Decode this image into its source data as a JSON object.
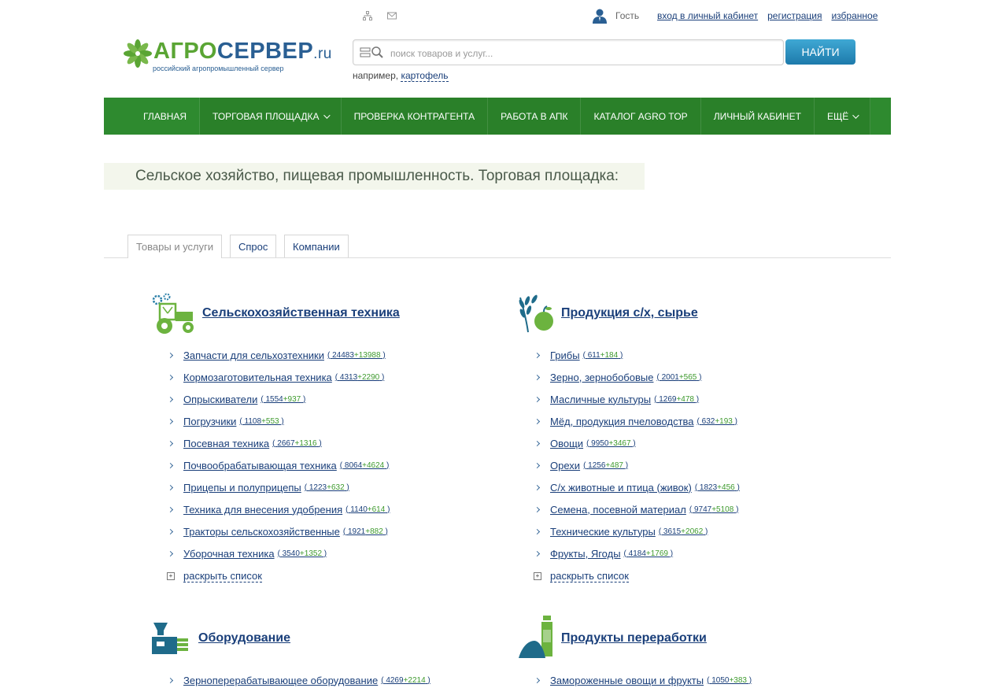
{
  "top": {
    "guest": "Гость",
    "links": [
      "вход в личный кабинет",
      "регистрация",
      "избранное"
    ]
  },
  "logo": {
    "agro": "АГРО",
    "server": "СЕРВЕР",
    "ru": ".ru",
    "subtitle": "российский агропромышленный сервер"
  },
  "search": {
    "placeholder": "поиск товаров и услуг...",
    "button": "НАЙТИ",
    "example_prefix": "например,",
    "example_link": "картофель"
  },
  "nav": [
    {
      "label": "Главная",
      "dropdown": false
    },
    {
      "label": "Торговая площадка",
      "dropdown": true
    },
    {
      "label": "Проверка контрагента",
      "dropdown": false
    },
    {
      "label": "Работа в АПК",
      "dropdown": false
    },
    {
      "label": "Каталог AGRO TOP",
      "dropdown": false
    },
    {
      "label": "Личный кабинет",
      "dropdown": false
    },
    {
      "label": "Ещё",
      "dropdown": true
    }
  ],
  "heading": "Сельское хозяйство, пищевая промышленность. Торговая площадка:",
  "tabs": [
    "Товары и услуги",
    "Спрос",
    "Компании"
  ],
  "expand_label": "раскрыть список",
  "categories": [
    {
      "title": "Сельскохозяйственная техника",
      "items": [
        {
          "name": "Запчасти для сельхозтехники",
          "a": "24483",
          "b": "+13988"
        },
        {
          "name": "Кормозаготовительная техника",
          "a": "4313",
          "b": "+2290"
        },
        {
          "name": "Опрыскиватели",
          "a": "1554",
          "b": "+937"
        },
        {
          "name": "Погрузчики",
          "a": "1108",
          "b": "+553"
        },
        {
          "name": "Посевная техника",
          "a": "2667",
          "b": "+1316"
        },
        {
          "name": "Почвообрабатывающая техника",
          "a": "8064",
          "b": "+4624"
        },
        {
          "name": "Прицепы и полуприцепы",
          "a": "1223",
          "b": "+632"
        },
        {
          "name": "Техника для внесения удобрения",
          "a": "1140",
          "b": "+614"
        },
        {
          "name": "Тракторы сельскохозяйственные",
          "a": "1921",
          "b": "+882"
        },
        {
          "name": "Уборочная техника",
          "a": "3540",
          "b": "+1352"
        }
      ]
    },
    {
      "title": "Продукция с/х, сырье",
      "items": [
        {
          "name": "Грибы",
          "a": "611",
          "b": "+184"
        },
        {
          "name": "Зерно, зернобобовые",
          "a": "2001",
          "b": "+565"
        },
        {
          "name": "Масличные культуры",
          "a": "1269",
          "b": "+478"
        },
        {
          "name": "Мёд, продукция пчеловодства",
          "a": "632",
          "b": "+193"
        },
        {
          "name": "Овощи",
          "a": "9950",
          "b": "+3467"
        },
        {
          "name": "Орехи",
          "a": "1256",
          "b": "+487"
        },
        {
          "name": "С/х животные и птица (живок)",
          "a": "1823",
          "b": "+456"
        },
        {
          "name": "Семена, посевной материал",
          "a": "9747",
          "b": "+5108"
        },
        {
          "name": "Технические культуры",
          "a": "3615",
          "b": "+2062"
        },
        {
          "name": "Фрукты, Ягоды",
          "a": "4184",
          "b": "+1769"
        }
      ]
    },
    {
      "title": "Оборудование",
      "items": [
        {
          "name": "Зерноперерабатывающее оборудование",
          "a": "4269",
          "b": "+2214"
        }
      ]
    },
    {
      "title": "Продукты переработки",
      "items": [
        {
          "name": "Замороженные овощи и фрукты",
          "a": "1050",
          "b": "+383"
        }
      ]
    }
  ]
}
